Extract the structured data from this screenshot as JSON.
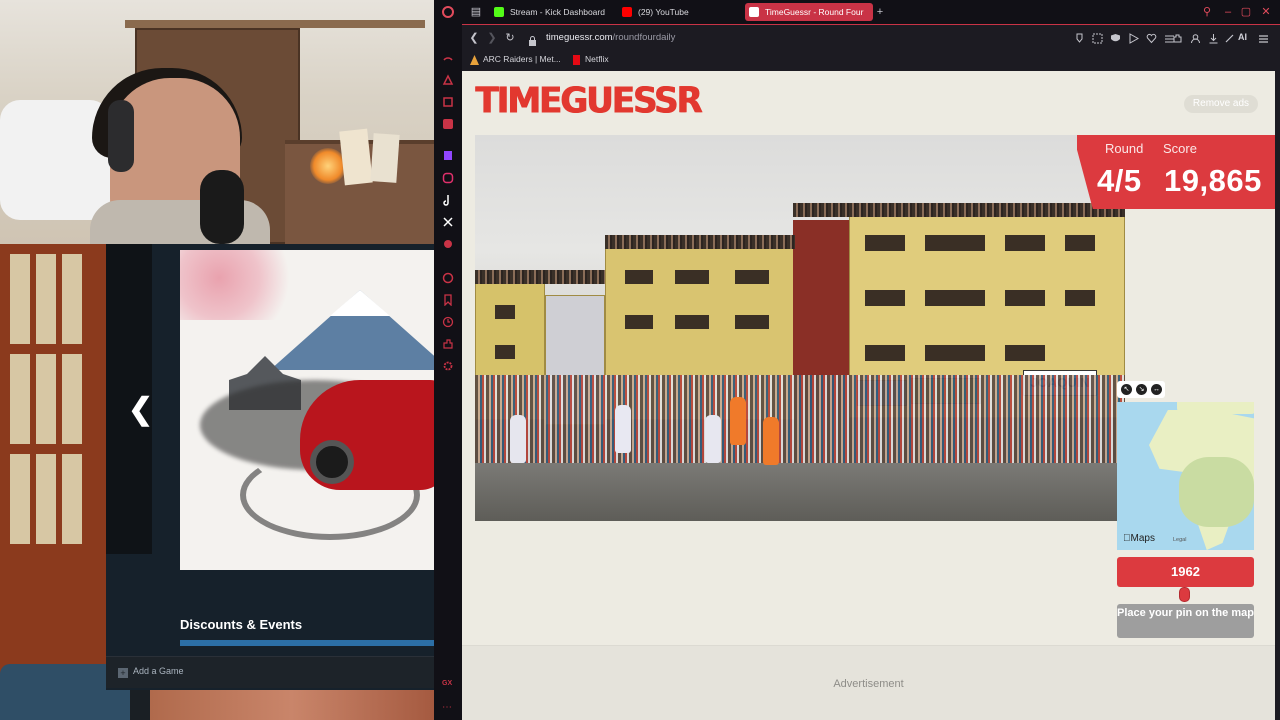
{
  "stream_overlay": {
    "game_section_title": "Discounts & Events",
    "add_game_label": "Add a Game"
  },
  "browser": {
    "tabs": [
      {
        "label": "Stream - Kick Dashboard",
        "icon": "kick-icon",
        "color": "#53fc18"
      },
      {
        "label": "(29) YouTube",
        "icon": "youtube-icon",
        "color": "#ff0000"
      },
      {
        "label": "TimeGuessr - Round Four",
        "icon": "timeguessr-icon",
        "color": "#e2382f",
        "active": true
      }
    ],
    "new_tab_symbol": "+",
    "url_host": "timeguessr.com",
    "url_path": "/roundfourdaily",
    "bookmarks": [
      {
        "label": "ARC Raiders | Met...",
        "icon": "arc-raiders-icon"
      },
      {
        "label": "Netflix",
        "icon": "netflix-icon"
      }
    ],
    "ai_label": "AI",
    "accent": "#c93346"
  },
  "page": {
    "logo": "TIMEGUESSR",
    "remove_ads": "Remove ads",
    "round_label": "Round",
    "round_value": "4/5",
    "score_label": "Score",
    "score_value": "19,865",
    "map_attribution": "Maps",
    "map_legal": "Legal",
    "year": "1962",
    "place_pin": "Place your pin on the map",
    "advertisement": "Advertisement",
    "photo_banner_text": "JOAQUIN",
    "accent": "#dc3a3f"
  }
}
